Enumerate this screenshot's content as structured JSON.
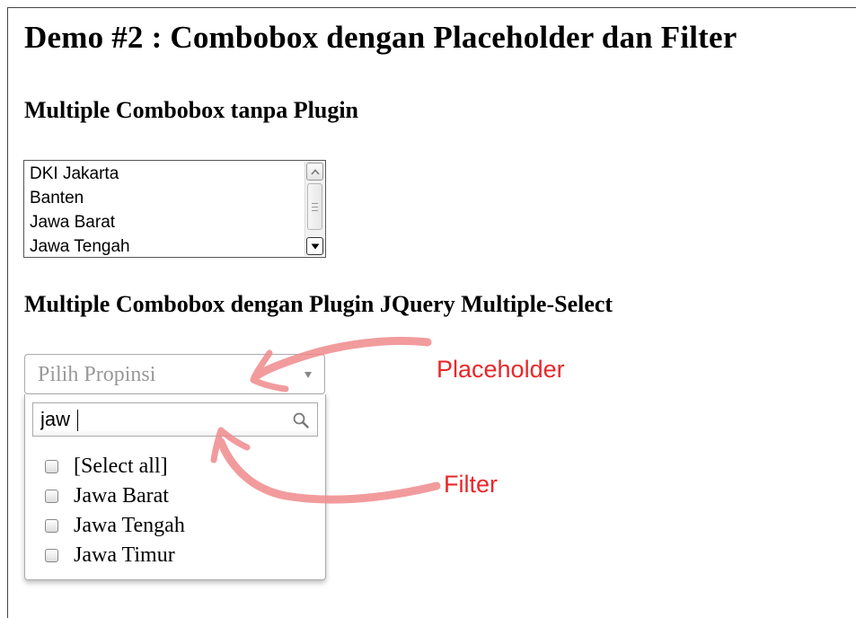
{
  "page": {
    "title": "Demo #2 : Combobox dengan Placeholder dan Filter"
  },
  "plain_section": {
    "heading": "Multiple Combobox tanpa Plugin",
    "options": [
      "DKI Jakarta",
      "Banten",
      "Jawa Barat",
      "Jawa Tengah"
    ]
  },
  "plugin_section": {
    "heading": "Multiple Combobox dengan Plugin JQuery Multiple-Select",
    "placeholder": "Pilih Propinsi",
    "filter_value": "jaw",
    "select_all_label": "[Select all]",
    "options": [
      "Jawa Barat",
      "Jawa Tengah",
      "Jawa Timur"
    ]
  },
  "annotations": {
    "placeholder_label": "Placeholder",
    "filter_label": "Filter",
    "color": "#e8272a"
  },
  "icons": {
    "search": "search-icon",
    "dropdown_arrow": "chevron-down-icon",
    "scroll_up": "scroll-up-icon",
    "scroll_down": "scroll-down-icon"
  }
}
